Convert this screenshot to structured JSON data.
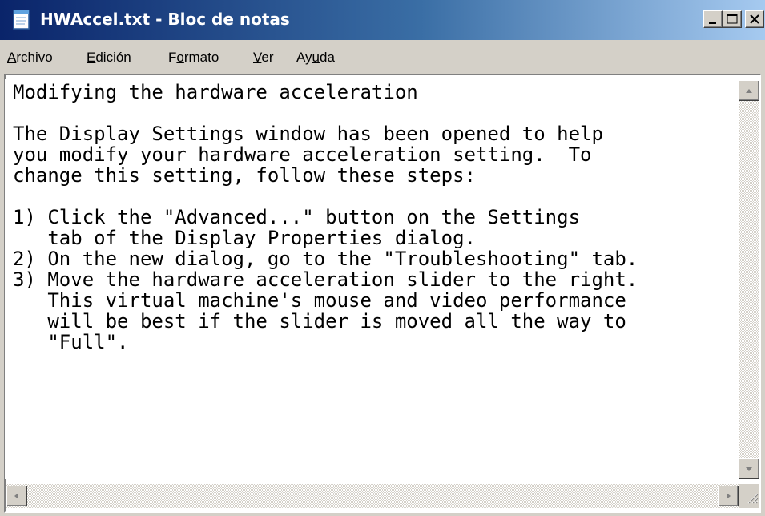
{
  "window": {
    "title": "HWAccel.txt - Bloc de notas",
    "icon": "notepad-icon"
  },
  "caption_buttons": {
    "minimize_icon": "minimize-icon",
    "maximize_icon": "maximize-icon",
    "close_icon": "close-icon"
  },
  "menu": {
    "items": [
      {
        "label": "Archivo",
        "accelerator": "A"
      },
      {
        "label": "Edición",
        "accelerator": "E"
      },
      {
        "label": "Formato",
        "accelerator": "o"
      },
      {
        "label": "Ver",
        "accelerator": "V"
      },
      {
        "label": "Ayuda",
        "accelerator": "u"
      }
    ]
  },
  "document": {
    "lines": [
      "Modifying the hardware acceleration",
      "",
      "The Display Settings window has been opened to help",
      "you modify your hardware acceleration setting.  To",
      "change this setting, follow these steps:",
      "",
      "1) Click the \"Advanced...\" button on the Settings",
      "   tab of the Display Properties dialog.",
      "2) On the new dialog, go to the \"Troubleshooting\" tab.",
      "3) Move the hardware acceleration slider to the right.",
      "   This virtual machine's mouse and video performance",
      "   will be best if the slider is moved all the way to",
      "   \"Full\"."
    ]
  },
  "colors": {
    "title_bar_start": "#0a246a",
    "title_bar_end": "#a6caf0",
    "face": "#d4d0c8",
    "text_background": "#ffffff"
  }
}
